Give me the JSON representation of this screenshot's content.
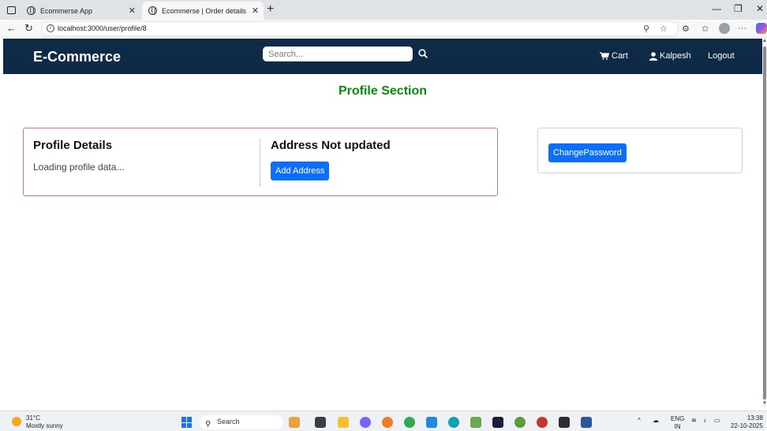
{
  "browser": {
    "tabs": [
      {
        "title": "Ecommerse App"
      },
      {
        "title": "Ecommerse | Order details"
      }
    ],
    "url": "localhost:3000/user/profile/8"
  },
  "navbar": {
    "brand": "E-Commerce",
    "search_placeholder": "Search...",
    "cart_label": "Cart",
    "user_label": "Kalpesh",
    "logout_label": "Logout",
    "bg_color": "#0e2a47"
  },
  "page": {
    "title": "Profile Section",
    "profile_heading": "Profile Details",
    "loading_text": "Loading profile data...",
    "address_heading": "Address Not updated",
    "add_address_label": "Add Address",
    "change_password_label": "ChangePassword",
    "title_color": "#0a8a0a",
    "button_color": "#0d6efd"
  },
  "taskbar": {
    "temperature": "31°C",
    "weather": "Mostly sunny",
    "search_label": "Search",
    "language": "ENG",
    "region": "IN",
    "time": "13:38",
    "date": "22-10-2025"
  }
}
